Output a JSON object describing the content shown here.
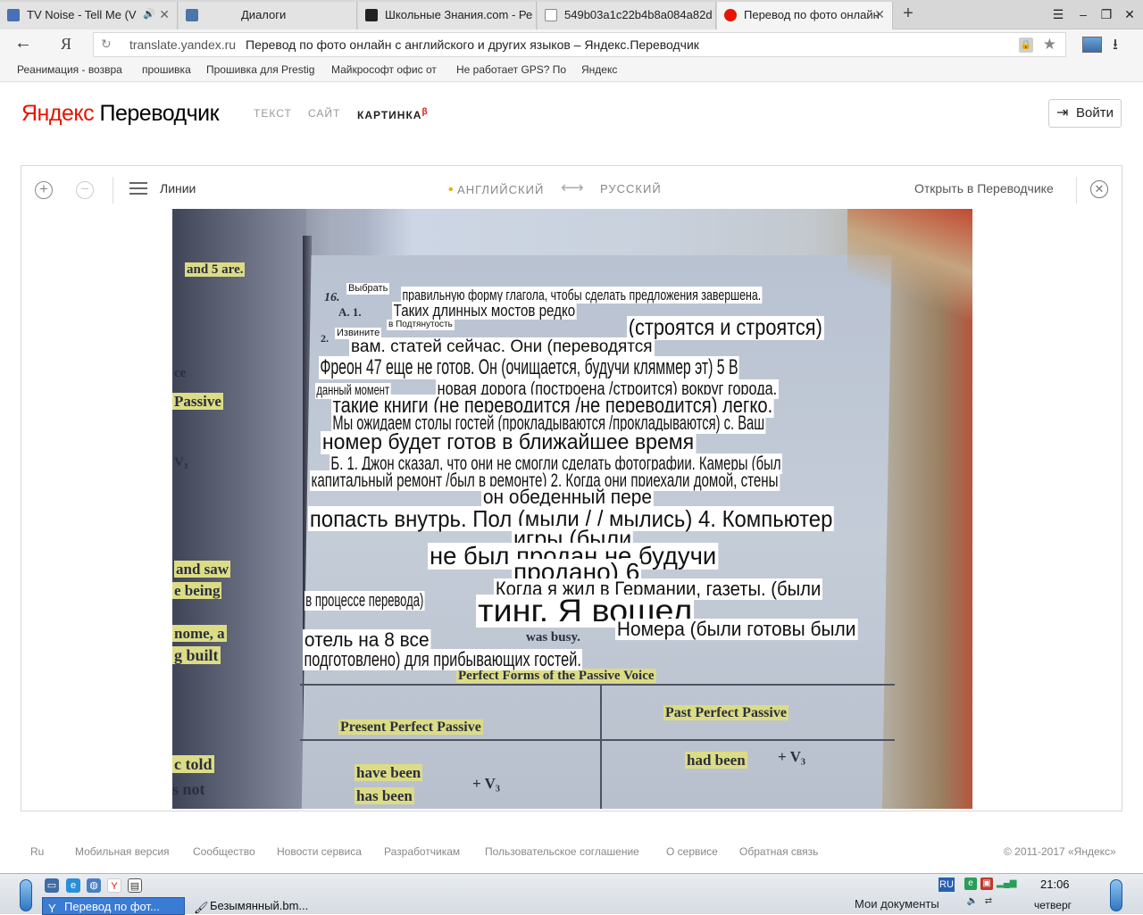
{
  "browser": {
    "tabs": [
      {
        "title": "TV Noise - Tell Me (V",
        "favicon_color": "#4a6fb5"
      },
      {
        "title": "Диалоги",
        "favicon_color": "#4a76a8"
      },
      {
        "title": "Школьные Знания.com - Ре",
        "favicon_color": "#222222"
      },
      {
        "title": "549b03a1c22b4b8a084a82d",
        "favicon_color": "#888888"
      },
      {
        "title": "Перевод по фото онлайн",
        "favicon_color": "#e61400"
      }
    ],
    "new_tab": "+",
    "window_controls": [
      "☰",
      "–",
      "❐",
      "✕"
    ],
    "back": "←",
    "home_glyph": "Я",
    "url_host": "translate.yandex.ru",
    "url_title": "Перевод по фото онлайн с английского и других языков – Яндекс.Переводчик",
    "bookmarks": [
      "Реанимация - возвра",
      "прошивка",
      "Прошивка для Prestig",
      "Майкрософт офис от",
      "Не работает GPS? По",
      "Яндекс"
    ]
  },
  "header": {
    "logo_ya": "Яндекс",
    "logo_rest": " Переводчик",
    "nav": [
      {
        "label": "ТЕКСТ"
      },
      {
        "label": "САЙТ"
      },
      {
        "label": "КАРТИНКА",
        "badge": "β"
      }
    ],
    "login_label": "Войти"
  },
  "toolbar": {
    "zoom_in": "+",
    "zoom_out": "−",
    "mode_label": "Линии",
    "source_lang": "АНГЛИЙСКИЙ",
    "swap": "⟷",
    "target_lang": "РУССКИЙ",
    "open_in_translator": "Открыть в Переводчике",
    "close": "✕"
  },
  "photo": {
    "page_texts": [
      "and 5 are.",
      "16.",
      "A. 1.",
      "2.",
      "ce",
      "Passive",
      "V₃",
      "and saw",
      "e being",
      "nome, a",
      "g built",
      "c told",
      "s not",
      "was busy.",
      "Perfect Forms of the Passive Voice",
      "Present Perfect Passive",
      "Past Perfect Passive",
      "have been",
      "has been",
      "+ V₃",
      "had been",
      "+ V₃"
    ],
    "overlays": [
      "Выбрать",
      "правильную форму глагола, чтобы сделать предложения завершена.",
      "Таких длинных мостов редко",
      "в Подтянутость",
      "(строятся и строятся)",
      "Извините",
      "вам. статей сейчас. Они (переводятся",
      "Фреон 47 еще не готов. Он (очищается, будучи кляммер эт) 5 В",
      "данный момент",
      "новая дорога (построена /строится) вокруг города.",
      "такие книги (не переводится /не переводится) легко.",
      "Мы ожидаем столы гостей (прокладываются /прокладываются) с. Ваш",
      "номер будет готов в ближайшее время",
      "Б. 1. Джон сказал, что они не смогли сделать фотографии. Камеры (был",
      "капитальный ремонт /был в ремонте) 2. Когда они приехали домой, стены",
      "он обеденный пере",
      "попасть внутрь. Пол (мыли / / мылись) 4. Компьютер",
      "игры (были",
      "не был продан не будучи",
      "продано) 6",
      "Когда я жил в Германии, газеты. (были",
      "в процессе перевода)",
      "тинг. Я вошел",
      "Номера (были готовы были",
      "отель на 8 все",
      "подготовлено) для прибывающих гостей."
    ]
  },
  "footer": {
    "links": [
      "Ru",
      "Мобильная версия",
      "Сообщество",
      "Новости сервиса",
      "Разработчикам",
      "Пользовательское соглашение",
      "О сервисе",
      "Обратная связь"
    ],
    "copyright": "© 2011-2017 «Яндекс»"
  },
  "taskbar": {
    "apps": [
      {
        "label": "Перевод по фот...",
        "active": true
      },
      {
        "label": "Безымянный.bm...",
        "active": false
      }
    ],
    "documents_label": "Мои документы",
    "lang": "RU",
    "time": "21:06",
    "day": "четверг"
  },
  "colors": {
    "brand_red": "#e61400",
    "accent_dot": "#f5a700",
    "highlight": "#dcdc86"
  }
}
